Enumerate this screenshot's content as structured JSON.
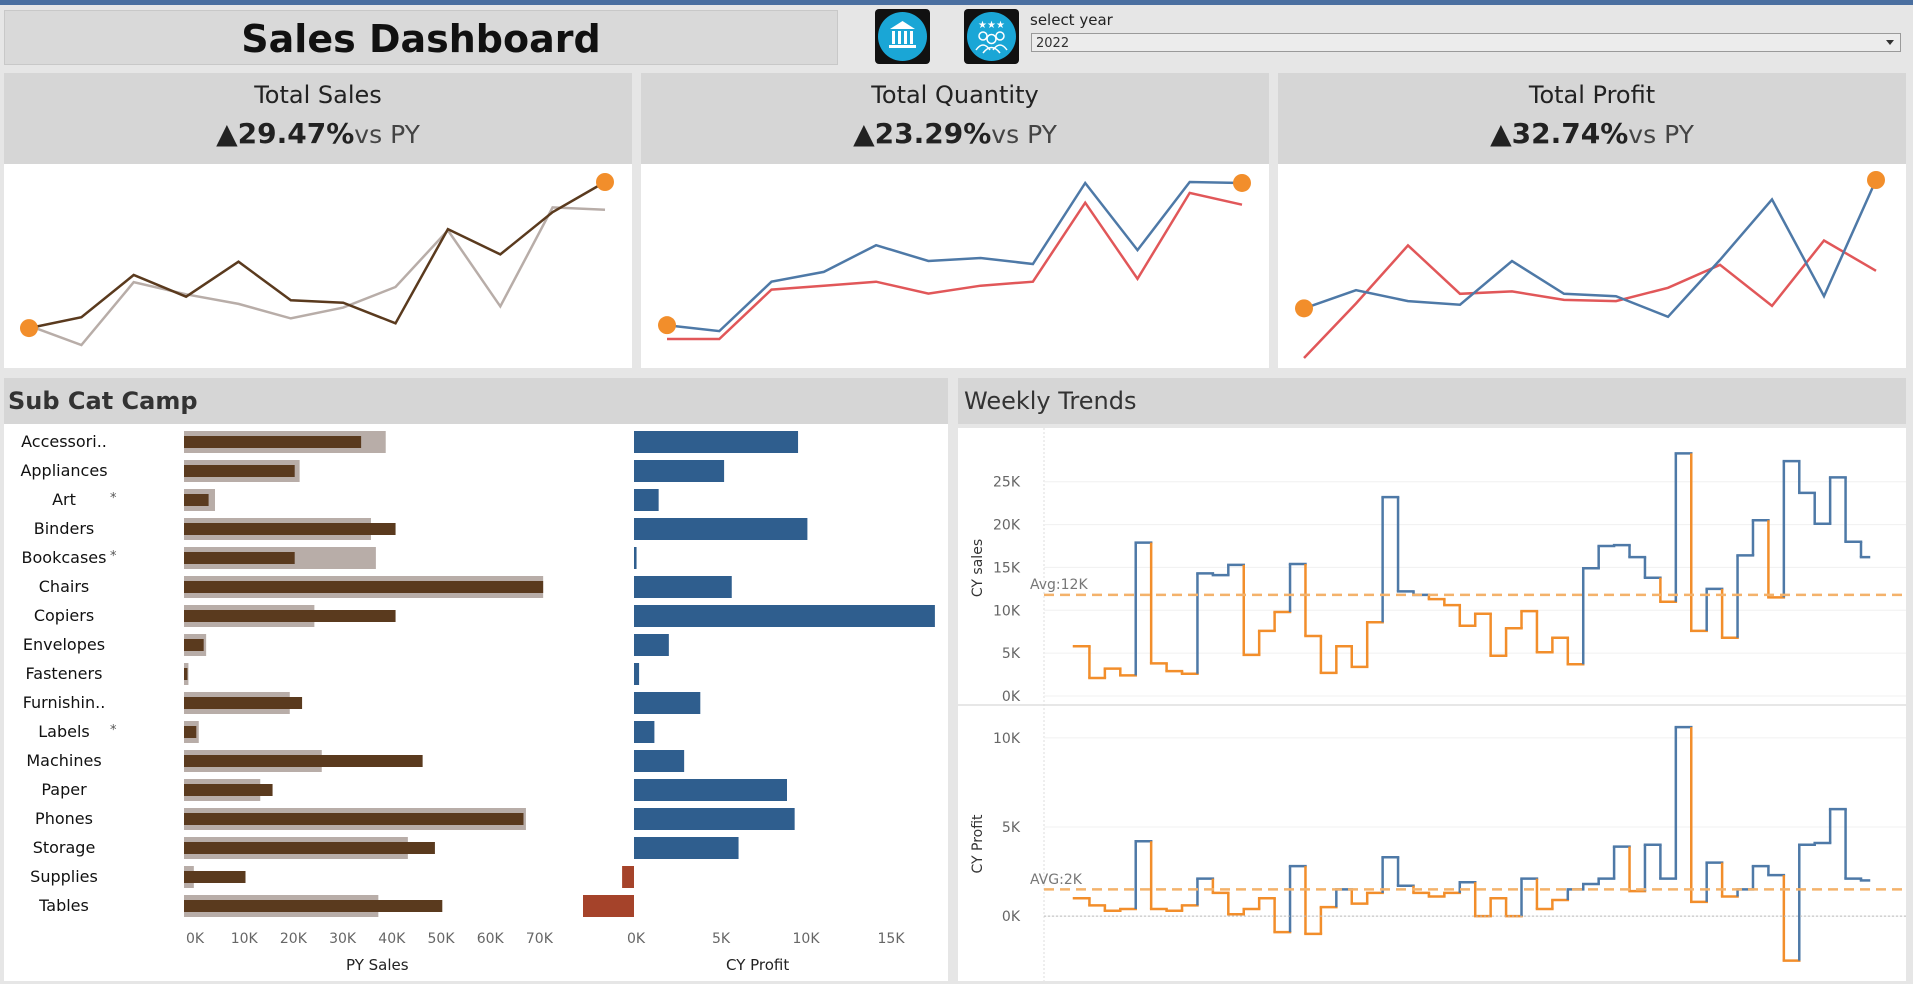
{
  "header": {
    "title": "Sales Dashboard",
    "icons": [
      "bank-icon",
      "team-award-icon"
    ],
    "select_label": "select year",
    "select_value": "2022"
  },
  "kpis": [
    {
      "title": "Total Sales",
      "change": "29.47%",
      "suffix": "vs PY",
      "direction": "up"
    },
    {
      "title": "Total Quantity",
      "change": "23.29%",
      "suffix": "vs PY",
      "direction": "up"
    },
    {
      "title": "Total Profit",
      "change": "32.74%",
      "suffix": "vs PY",
      "direction": "up"
    }
  ],
  "colors": {
    "cy_brown": "#5a3a1e",
    "py_grey": "#b8ada8",
    "blue": "#4e79a7",
    "red": "#e15759",
    "orange": "#f28e2b",
    "bar_blue": "#2f5e8e",
    "bar_neg": "#a5432a"
  },
  "subcat": {
    "title": "Sub Cat Camp",
    "py_axis_title": "PY Sales",
    "cy_axis_title": "CY Profit"
  },
  "weekly": {
    "title": "Weekly Trends",
    "sales_avg_label": "Avg:12K",
    "profit_avg_label": "AVG:2K"
  },
  "chart_data": [
    {
      "type": "line",
      "id": "sales-sparkline",
      "x": [
        1,
        2,
        3,
        4,
        5,
        6,
        7,
        8,
        9,
        10,
        11,
        12
      ],
      "series": [
        {
          "values": [
            14,
            23,
            58,
            40,
            69,
            37,
            35,
            18,
            96,
            75,
            110,
            135
          ]
        },
        {
          "values": [
            16,
            0,
            52,
            42,
            34,
            22,
            31,
            48,
            95,
            32,
            114,
            112
          ]
        }
      ]
    },
    {
      "type": "line",
      "id": "quantity-sparkline",
      "x": [
        1,
        2,
        3,
        4,
        5,
        6,
        7,
        8,
        9,
        10,
        11,
        12
      ],
      "series": [
        {
          "values": [
            18,
            12,
            62,
            72,
            99,
            83,
            86,
            80,
            162,
            94,
            163,
            162
          ]
        },
        {
          "values": [
            4,
            4,
            54,
            58,
            62,
            50,
            58,
            62,
            142,
            65,
            152,
            140
          ]
        }
      ]
    },
    {
      "type": "line",
      "id": "profit-sparkline",
      "x": [
        1,
        2,
        3,
        4,
        5,
        6,
        7,
        8,
        9,
        10,
        11,
        12
      ],
      "series": [
        {
          "values": [
            41,
            56,
            47,
            44,
            80,
            53,
            51,
            34,
            81,
            131,
            51,
            147
          ]
        },
        {
          "values": [
            0,
            45,
            93,
            53,
            55,
            48,
            47,
            58,
            77,
            43,
            97,
            72
          ]
        }
      ]
    },
    {
      "type": "bar",
      "id": "py-sales-bars",
      "categories": [
        "Accessori..",
        "Appliances",
        "Art",
        "Binders",
        "Bookcases",
        "Chairs",
        "Copiers",
        "Envelopes",
        "Fasteners",
        "Furnishin..",
        "Labels",
        "Machines",
        "Paper",
        "Phones",
        "Storage",
        "Supplies",
        "Tables"
      ],
      "flagged": [
        "Art",
        "Bookcases",
        "Labels"
      ],
      "series": [
        {
          "role": "py",
          "values": [
            41000,
            23500,
            6300,
            38000,
            39000,
            73000,
            26500,
            4500,
            900,
            21500,
            3000,
            28000,
            15500,
            69500,
            45500,
            2000,
            39500
          ]
        },
        {
          "role": "cy",
          "values": [
            36000,
            22500,
            5000,
            43000,
            22500,
            73000,
            43000,
            4000,
            700,
            24000,
            2500,
            48500,
            18000,
            69000,
            51000,
            12500,
            52500
          ]
        }
      ],
      "xlim": [
        0,
        75000
      ],
      "xticks": [
        "0K",
        "10K",
        "20K",
        "30K",
        "40K",
        "50K",
        "60K",
        "70K"
      ]
    },
    {
      "type": "bar",
      "id": "cy-profit-bars",
      "categories": [
        "Accessori..",
        "Appliances",
        "Art",
        "Binders",
        "Bookcases",
        "Chairs",
        "Copiers",
        "Envelopes",
        "Fasteners",
        "Furnishin..",
        "Labels",
        "Machines",
        "Paper",
        "Phones",
        "Storage",
        "Supplies",
        "Tables"
      ],
      "values": [
        9650,
        5300,
        1450,
        10200,
        150,
        5750,
        17700,
        2050,
        300,
        3900,
        1200,
        2950,
        9000,
        9450,
        6150,
        -700,
        -3000
      ],
      "xlim": [
        -3000,
        18000
      ],
      "xticks": [
        "0K",
        "5K",
        "10K",
        "15K"
      ]
    },
    {
      "type": "line",
      "id": "weekly-sales",
      "ylabel": "CY sales",
      "yticks": [
        "0K",
        "5K",
        "10K",
        "15K",
        "20K",
        "25K"
      ],
      "ylim": [
        0,
        28000
      ],
      "average": 11800,
      "values": [
        5800,
        2100,
        3200,
        2400,
        17900,
        3800,
        2900,
        2600,
        14300,
        14100,
        15300,
        4800,
        7600,
        9800,
        15400,
        7000,
        2700,
        5800,
        3400,
        8600,
        23200,
        12200,
        11800,
        11300,
        10600,
        8200,
        9600,
        4700,
        7900,
        9900,
        5100,
        6800,
        3700,
        14900,
        17500,
        17600,
        16200,
        13800,
        11000,
        28300,
        7600,
        12500,
        6800,
        16400,
        20500,
        11500,
        27400,
        23700,
        20100,
        25500,
        18000,
        16200
      ]
    },
    {
      "type": "line",
      "id": "weekly-profit",
      "ylabel": "CY Profit",
      "yticks": [
        "0K",
        "5K",
        "10K"
      ],
      "ylim": [
        -2800,
        11000
      ],
      "average": 1500,
      "values": [
        1000,
        600,
        300,
        400,
        4200,
        400,
        300,
        600,
        2100,
        1300,
        100,
        400,
        1000,
        -900,
        2800,
        -1000,
        500,
        1500,
        700,
        1300,
        3300,
        1700,
        1300,
        1100,
        1300,
        1900,
        0,
        1000,
        0,
        2100,
        400,
        900,
        1500,
        1800,
        2100,
        3900,
        1400,
        4000,
        2100,
        10600,
        800,
        3000,
        1100,
        1500,
        2800,
        2300,
        -2500,
        4000,
        4100,
        6000,
        2100,
        2000
      ]
    }
  ]
}
